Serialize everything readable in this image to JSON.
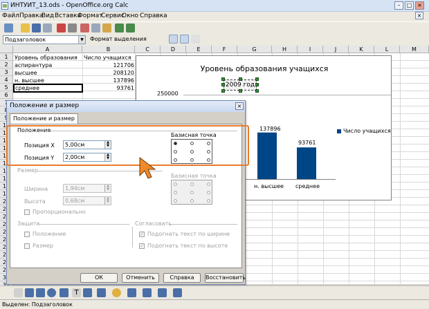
{
  "window": {
    "title": "ИНТУИТ_13.ods - OpenOffice.org Calc"
  },
  "menu": [
    "Файл",
    "Правка",
    "Вид",
    "Вставка",
    "Формат",
    "Сервис",
    "Окно",
    "Справка"
  ],
  "style_box": {
    "value": "Подзаголовок",
    "format_selection": "Формат выделения"
  },
  "sheet": {
    "columns": [
      "A",
      "B",
      "C",
      "D",
      "E",
      "F",
      "G",
      "H",
      "I",
      "J",
      "K",
      "L",
      "M"
    ],
    "rows": [
      "1",
      "2",
      "3",
      "4",
      "5",
      "6",
      "7",
      "8",
      "9",
      "10",
      "11",
      "12",
      "13",
      "14",
      "15",
      "16",
      "17",
      "18",
      "19",
      "20",
      "21",
      "22",
      "23",
      "24",
      "25",
      "26",
      "27",
      "28",
      "29",
      "30",
      "31"
    ],
    "cells": [
      {
        "a": "Уровень образования",
        "b": "Число учащихся"
      },
      {
        "a": "аспирантура",
        "b": "121706"
      },
      {
        "a": "высшее",
        "b": "208120"
      },
      {
        "a": "н. высшее",
        "b": "137896"
      },
      {
        "a": "среднее",
        "b": "93761"
      }
    ]
  },
  "chart": {
    "title": "Уровень образования учащихся",
    "subtitle": "2009 год",
    "y_top_label": "250000",
    "visible_bars": [
      {
        "label": "н. высшее",
        "value": "137896"
      },
      {
        "label": "среднее",
        "value": "93761"
      }
    ],
    "legend": "Число учащихся",
    "bar_color": "#004586"
  },
  "chart_data": {
    "type": "bar",
    "title": "Уровень образования учащихся",
    "subtitle": "2009 год",
    "categories": [
      "аспирантура",
      "высшее",
      "н. высшее",
      "среднее"
    ],
    "series": [
      {
        "name": "Число учащихся",
        "values": [
          121706,
          208120,
          137896,
          93761
        ]
      }
    ],
    "ylim": [
      0,
      250000
    ],
    "legend": "right"
  },
  "dialog": {
    "title": "Положение и размер",
    "tab": "Положение и размер",
    "position": {
      "section": "Положение",
      "pos_x_label": "Позиция X",
      "pos_x": "5,00см",
      "pos_y_label": "Позиция Y",
      "pos_y": "2,00см",
      "base_point": "Базисная точка"
    },
    "size": {
      "section": "Размер",
      "width_label": "Ширина",
      "width": "1,94см",
      "height_label": "Высота",
      "height": "0,68см",
      "proportional": "Пропорционально",
      "base_point": "Базисная точка"
    },
    "protect": {
      "section": "Защита",
      "position": "Положение",
      "size": "Размер"
    },
    "adapt": {
      "section": "Согласовать",
      "fit_width": "Подогнать текст по ширине",
      "fit_height": "Подогнать текст по высоте"
    },
    "buttons": {
      "ok": "ОК",
      "cancel": "Отменить",
      "help": "Справка",
      "reset": "Восстановить"
    }
  },
  "status": {
    "text": "Выделен: Подзаголовок"
  }
}
